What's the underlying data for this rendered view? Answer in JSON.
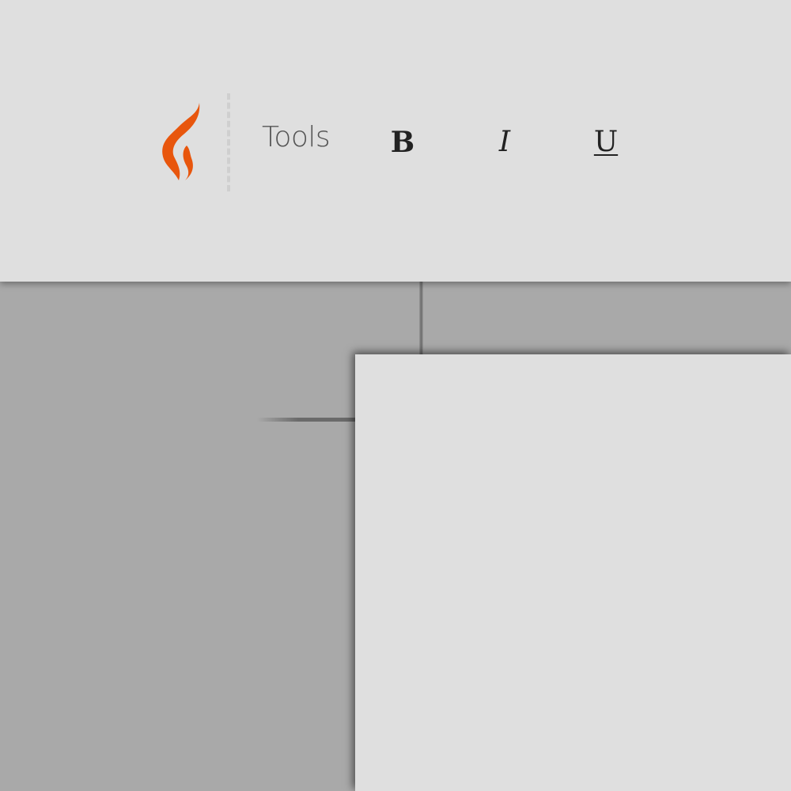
{
  "toolbar": {
    "logo_icon": "flame-logo-icon",
    "brand_color": "#e8560d",
    "tools_label": "Tools",
    "bold_label": "B",
    "italic_label": "I",
    "underline_label": "U"
  },
  "workspace": {
    "background_color": "#a9a9a9",
    "page_color": "#dfdfdf"
  }
}
